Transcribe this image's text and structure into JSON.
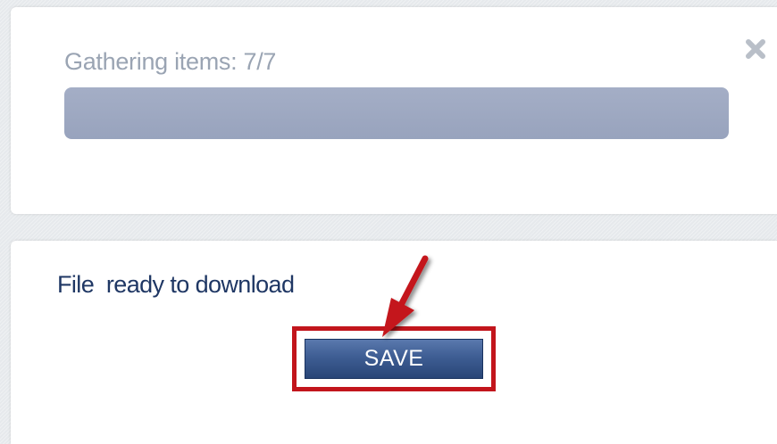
{
  "progress": {
    "label": "Gathering items: 7/7",
    "value": 1.0
  },
  "close": {
    "icon": "close-icon",
    "color": "#b9bfc8"
  },
  "download": {
    "status_text": "File  ready to download",
    "save_label": "SAVE"
  },
  "colors": {
    "progress_fill": "#9ba6bf",
    "status_text": "#1f3764",
    "button_bg": "#3e5d93",
    "highlight": "#c2151c"
  }
}
